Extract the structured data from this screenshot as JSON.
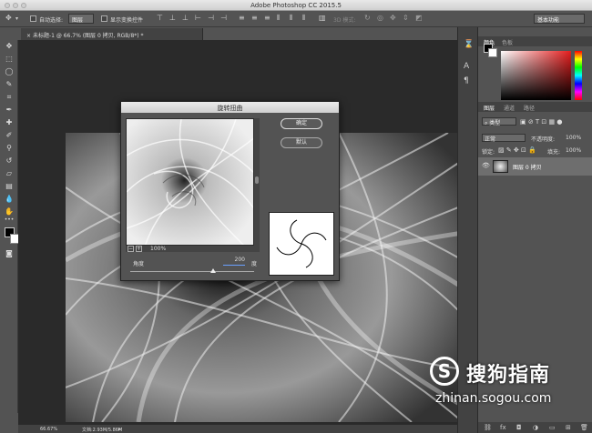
{
  "app": {
    "title": "Adobe Photoshop CC 2015.5"
  },
  "options_bar": {
    "auto_select_label": "自动选择:",
    "auto_select_value": "图层",
    "show_transform_label": "显示变换控件",
    "mode_3d_label": "3D 模式:",
    "workspace": "基本功能"
  },
  "document": {
    "tab_label": "未标题-1 @ 66.7% (图层 0 拷贝, RGB/8*) *"
  },
  "status_bar": {
    "zoom": "66.67%",
    "doc_info": "文档:2.93M/5.86M"
  },
  "color_panel": {
    "tab_color": "颜色",
    "tab_swatches": "色板"
  },
  "layers_panel": {
    "tab_layers": "图层",
    "tab_channels": "通道",
    "tab_paths": "路径",
    "kind_filter": "类型",
    "blend_mode": "正常",
    "opacity_label": "不透明度:",
    "opacity_value": "100%",
    "lock_label": "锁定:",
    "fill_label": "填充:",
    "fill_value": "100%",
    "layer_name": "图层 0 拷贝"
  },
  "twirl_dialog": {
    "title": "旋转扭曲",
    "ok_label": "确定",
    "default_label": "默认",
    "zoom_value": "100%",
    "angle_label": "角度",
    "angle_value": "200",
    "angle_unit": "度",
    "angle_slider_fraction": 0.67
  },
  "watermark": {
    "logo_letter": "S",
    "brand": "搜狗指南",
    "url": "zhinan.sogou.com"
  },
  "colors": {
    "foreground": "#000000",
    "background": "#ffffff",
    "accent": "#6aa0ff"
  }
}
